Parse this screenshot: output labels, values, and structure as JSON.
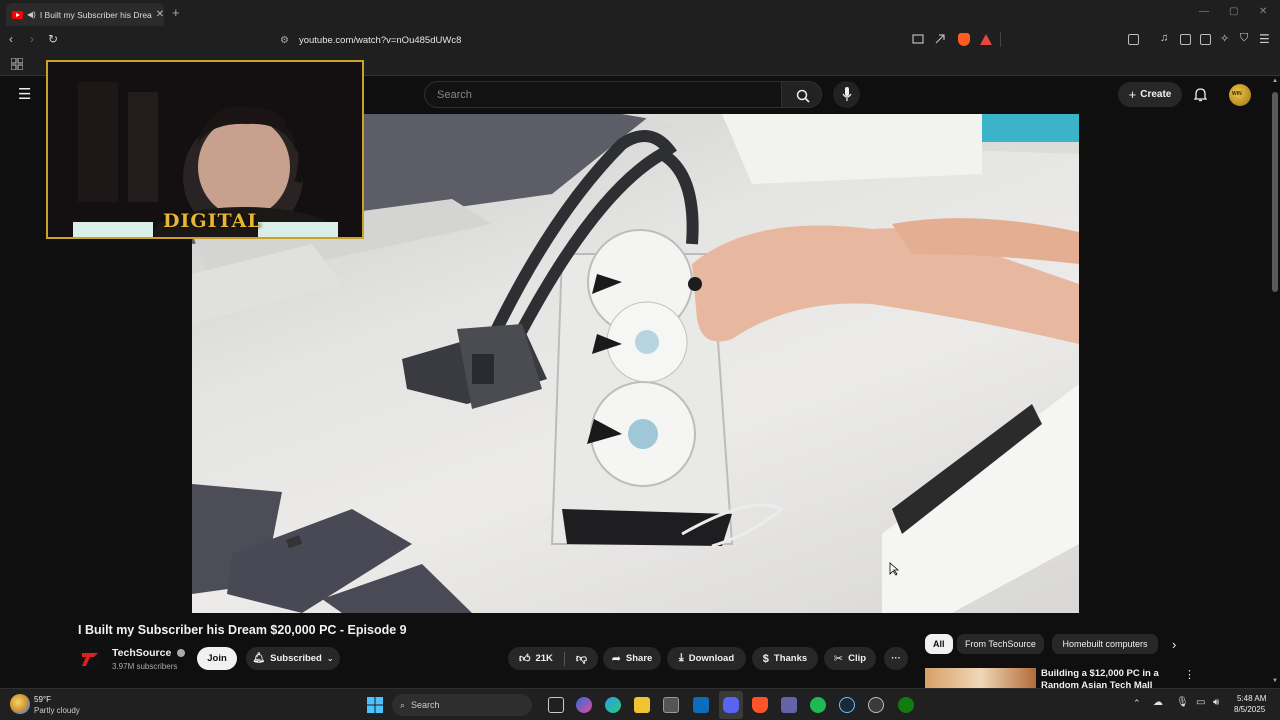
{
  "browser": {
    "tab_title": "I Built my Subscriber his Drea",
    "tab_close": "✕",
    "new_tab": "+",
    "url": "youtube.com/watch?v=nOu485dUWc8"
  },
  "youtube": {
    "search_placeholder": "Search",
    "create_label": "Create",
    "avatar_text": "WIN"
  },
  "webcam": {
    "logo_text": "DIGITAL"
  },
  "video": {
    "title": "I Built my Subscriber his Dream $20,000 PC - Episode 9",
    "channel": "TechSource",
    "subscribers": "3.97M subscribers",
    "join_label": "Join",
    "subscribed_label": "Subscribed",
    "likes": "21K",
    "share_label": "Share",
    "download_label": "Download",
    "thanks_label": "Thanks",
    "clip_label": "Clip",
    "more_label": "···"
  },
  "chips": [
    "All",
    "From TechSource",
    "Homebuilt computers"
  ],
  "recommendation": {
    "title_line1": "Building a $12,000 PC in a",
    "title_line2": "Random Asian Tech Mall"
  },
  "taskbar": {
    "temperature": "59°F",
    "weather": "Partly cloudy",
    "search_label": "Search",
    "time": "5:48 AM",
    "date": "8/5/2025"
  },
  "colors": {
    "accent_red": "#ff0000",
    "gold": "#c9a227",
    "background": "#0f0f0f"
  }
}
